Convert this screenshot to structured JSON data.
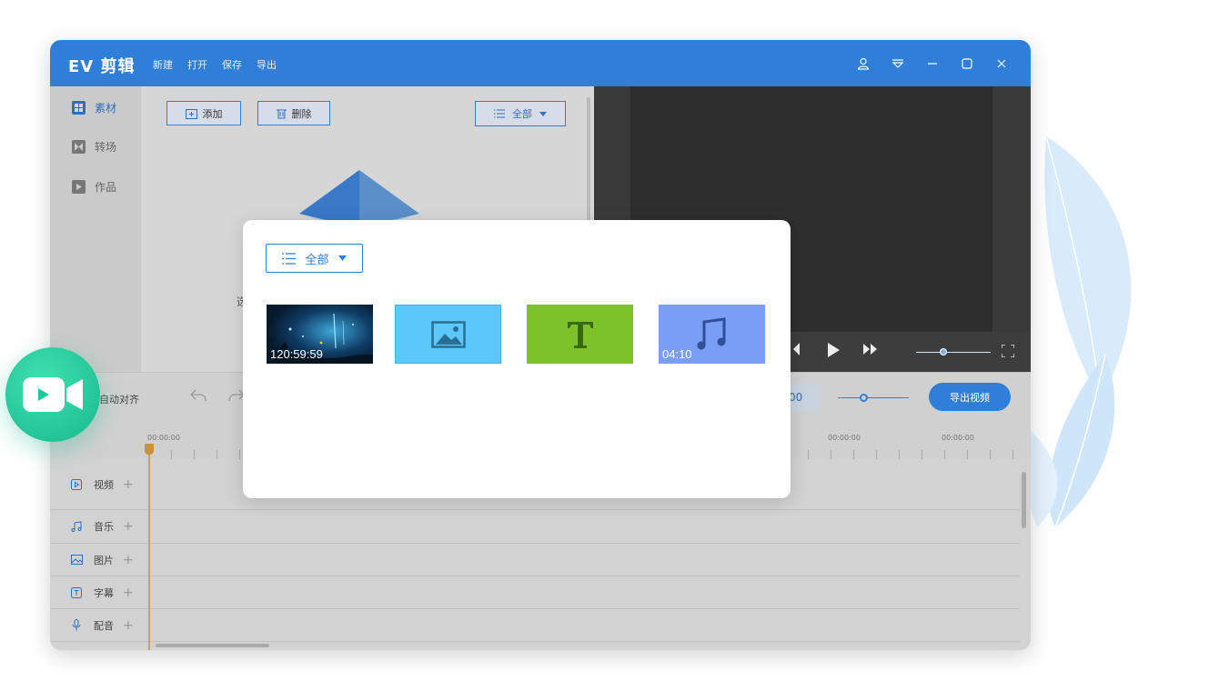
{
  "app": {
    "title": "EV 剪辑",
    "menu": [
      "新建",
      "打开",
      "保存",
      "导出"
    ]
  },
  "sidebar": {
    "items": [
      {
        "label": "素材",
        "active": true
      },
      {
        "label": "转场",
        "active": false
      },
      {
        "label": "作品",
        "active": false
      }
    ]
  },
  "toolbar": {
    "add_label": "添加",
    "delete_label": "删除",
    "filter_label": "全部"
  },
  "library": {
    "placeholder_fragment": "选"
  },
  "timeline_toolbar": {
    "auto_align_label": "自动对齐",
    "time_value": "00",
    "export_label": "导出视频"
  },
  "ruler": {
    "labels": [
      "00:00:00",
      "00:00:00",
      "00:00:00"
    ]
  },
  "tracks": [
    {
      "label": "视频",
      "icon": "video-track-icon"
    },
    {
      "label": "音乐",
      "icon": "music-track-icon"
    },
    {
      "label": "图片",
      "icon": "image-track-icon"
    },
    {
      "label": "字幕",
      "icon": "text-track-icon"
    },
    {
      "label": "配音",
      "icon": "mic-track-icon"
    }
  ],
  "modal": {
    "filter_label": "全部",
    "thumbnails": [
      {
        "type": "video",
        "duration": "120:59:59"
      },
      {
        "type": "image",
        "color": "#5cc8fa"
      },
      {
        "type": "text",
        "color": "#7ec22a"
      },
      {
        "type": "audio",
        "color": "#7b9ef5",
        "duration": "04:10"
      }
    ]
  },
  "colors": {
    "accent": "#2f7ed8",
    "badge": "#1fc79a"
  }
}
